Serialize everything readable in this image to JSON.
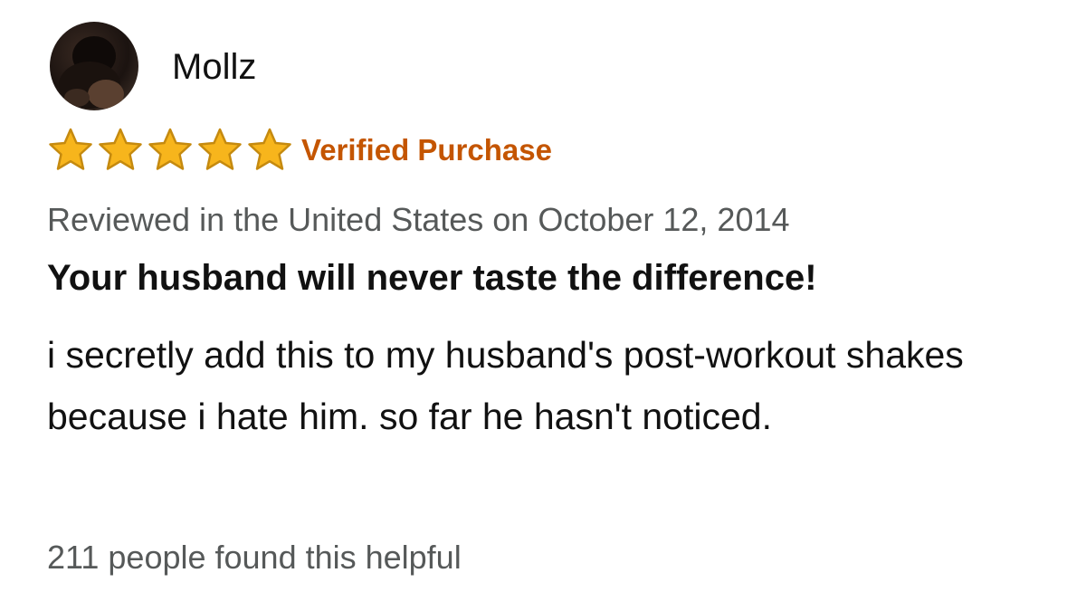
{
  "review": {
    "author": "Mollz",
    "rating": 5,
    "rating_max": 5,
    "verified_label": "Verified Purchase",
    "meta": "Reviewed in the United States on October 12, 2014",
    "title": "Your husband will never taste the difference!",
    "body": "i secretly add this to my husband's post-workout shakes because i hate him. so far he hasn't noticed.",
    "helpful": "211 people found this helpful"
  },
  "colors": {
    "star_fill": "#f7b51c",
    "star_stroke": "#c58a0f",
    "verified": "#c45500",
    "meta_text": "#565959"
  },
  "icons": {
    "avatar": "user-avatar-photo",
    "star": "star-icon"
  }
}
